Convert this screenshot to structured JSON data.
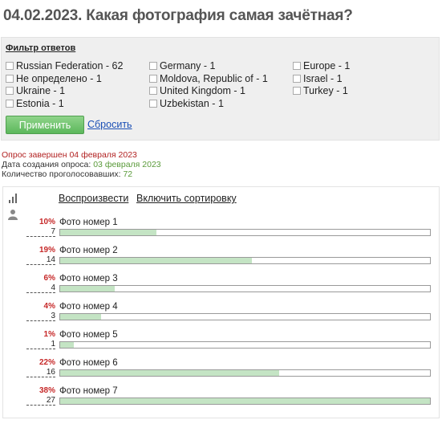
{
  "page": {
    "title": "04.02.2023. Какая фотография самая зачётная?"
  },
  "filter": {
    "title": "Фильтр ответов",
    "items": [
      {
        "label": "Russian Federation - 62"
      },
      {
        "label": "Не определено - 1"
      },
      {
        "label": "Ukraine - 1"
      },
      {
        "label": "Estonia - 1"
      },
      {
        "label": "Germany - 1"
      },
      {
        "label": "Moldova, Republic of - 1"
      },
      {
        "label": "United Kingdom - 1"
      },
      {
        "label": "Uzbekistan - 1"
      },
      {
        "label": "Europe - 1"
      },
      {
        "label": "Israel - 1"
      },
      {
        "label": "Turkey - 1"
      }
    ],
    "apply_label": "Применить",
    "reset_label": "Сбросить"
  },
  "info": {
    "closed_text": "Опрос завершен 04 февраля 2023",
    "created_label": "Дата создания опроса:",
    "created_value": "03 февраля 2023",
    "voters_label": "Количество проголосовавших:",
    "voters_value": "72"
  },
  "results": {
    "icons": [
      "bar-chart-icon",
      "user-icon"
    ],
    "play_label": "Воспроизвести",
    "sort_label": "Включить сортировку",
    "options": [
      {
        "label": "Фото номер 1",
        "percent": "10%",
        "count": "7",
        "value": 7
      },
      {
        "label": "Фото номер 2",
        "percent": "19%",
        "count": "14",
        "value": 14
      },
      {
        "label": "Фото номер 3",
        "percent": "6%",
        "count": "4",
        "value": 4
      },
      {
        "label": "Фото номер 4",
        "percent": "4%",
        "count": "3",
        "value": 3
      },
      {
        "label": "Фото номер 5",
        "percent": "1%",
        "count": "1",
        "value": 1
      },
      {
        "label": "Фото номер 6",
        "percent": "22%",
        "count": "16",
        "value": 16
      },
      {
        "label": "Фото номер 7",
        "percent": "38%",
        "count": "27",
        "value": 27
      }
    ],
    "max_value": 27
  },
  "colors": {
    "percent": "#c62828",
    "bar_fill": "#c4e4c4",
    "apply_button": "#5cb85c",
    "link": "#1a4fb5",
    "closed_text": "#b22222",
    "info_value": "#5a9a3a"
  }
}
